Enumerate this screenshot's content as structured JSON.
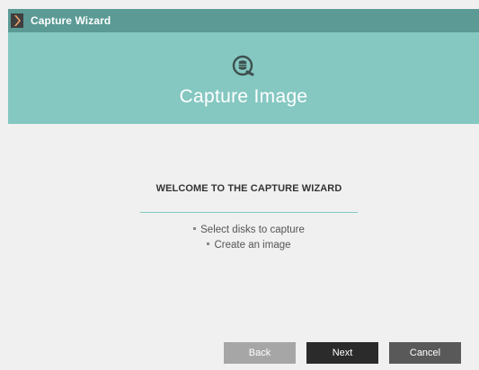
{
  "window": {
    "title": "Capture Wizard"
  },
  "header": {
    "icon": "database-search-icon",
    "title": "Capture Image"
  },
  "main": {
    "heading": "WELCOME TO THE CAPTURE WIZARD",
    "bullets": [
      "Select disks to capture",
      "Create an image"
    ]
  },
  "buttons": {
    "back": "Back",
    "next": "Next",
    "cancel": "Cancel"
  },
  "colors": {
    "titlebar": "#5b9a95",
    "header": "#85c7c1",
    "accent_line": "#86c8c2",
    "button_back": "#a6a6a6",
    "button_next": "#2b2b2b",
    "button_cancel": "#595959"
  }
}
